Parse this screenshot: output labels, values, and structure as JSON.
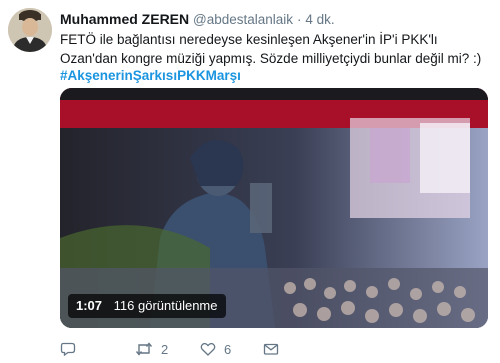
{
  "tweet": {
    "author_name": "Muhammed ZEREN",
    "author_handle": "@abdestalanlaik",
    "separator": "·",
    "time": "4 dk.",
    "text": "FETÖ ile bağlantısı neredeyse kesinleşen Akşener'in İP'i PKK'lı Ozan'dan kongre müziği yapmış. Sözde milliyetçiydi bunlar değil mi? :)",
    "hashtag": "#AkşenerinŞarkısıPKKMarşı"
  },
  "video": {
    "duration": "1:07",
    "views": "116 görüntülenme"
  },
  "actions": {
    "reply_count": "",
    "retweet_count": "2",
    "like_count": "6",
    "icons": [
      "reply-icon",
      "retweet-icon",
      "like-icon",
      "direct-message-icon"
    ]
  },
  "colors": {
    "link": "#1b95e0",
    "secondary_text": "#657786"
  }
}
